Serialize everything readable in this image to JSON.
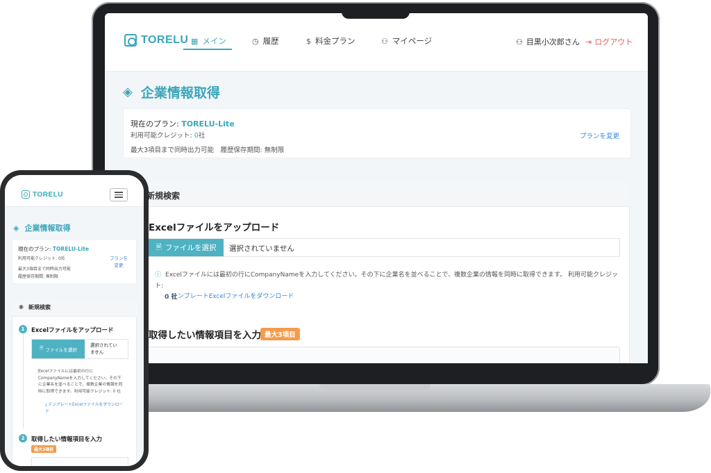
{
  "app": {
    "logo": "TORELU"
  },
  "nav": {
    "main": "メイン",
    "history": "履歴",
    "pricing": "料金プラン",
    "mypage": "マイページ",
    "user": "目黒小次郎さん",
    "logout": "ログアウト"
  },
  "page": {
    "title": "企業情報取得"
  },
  "plan": {
    "label": "現在のプラン: ",
    "name": "TORELU-Lite",
    "credit_label": "利用可能クレジット: ",
    "credit_value": "0",
    "credit_unit": "社",
    "limits": "最大3項目まで同時出力可能　履歴保存期間: 無制限",
    "limits_line1": "最大3項目まで同時出力可能",
    "limits_line2": "履歴保存期間: 無制限",
    "change": "プランを変更",
    "change_mobile_1": "プランを",
    "change_mobile_2": "変更"
  },
  "search": {
    "header": "新規検索",
    "upload_title": "Excelファイルをアップロード",
    "file_button": "ファイルを選択",
    "file_status": "選択されていません",
    "file_status_mobile_1": "選択されてい",
    "file_status_mobile_2": "ません",
    "info": "Excelファイルには最初の行にCompanyNameを入力してください。その下に企業名を並べることで、複数企業の情報を同時に取得できます。 利用可能クレジット: ",
    "info_credit": "0 社",
    "info_mobile": "Excelファイルには最初の行にCompanyNameを入力してください。その下に企業名を並べることで、複数企業の情報を同時に取得できます。利用可能クレジット: 0 社",
    "template_link": "テンプレートExcelファイルをダウンロード",
    "items_title": "取得したい情報項目を入力",
    "items_badge": "最大3項目",
    "step1": "1",
    "step2": "2"
  },
  "colors": {
    "accent": "#3aa6b9",
    "button": "#4eb2c2",
    "link": "#3a86d9",
    "badge": "#f39c4f",
    "logout": "#e35d5d"
  }
}
